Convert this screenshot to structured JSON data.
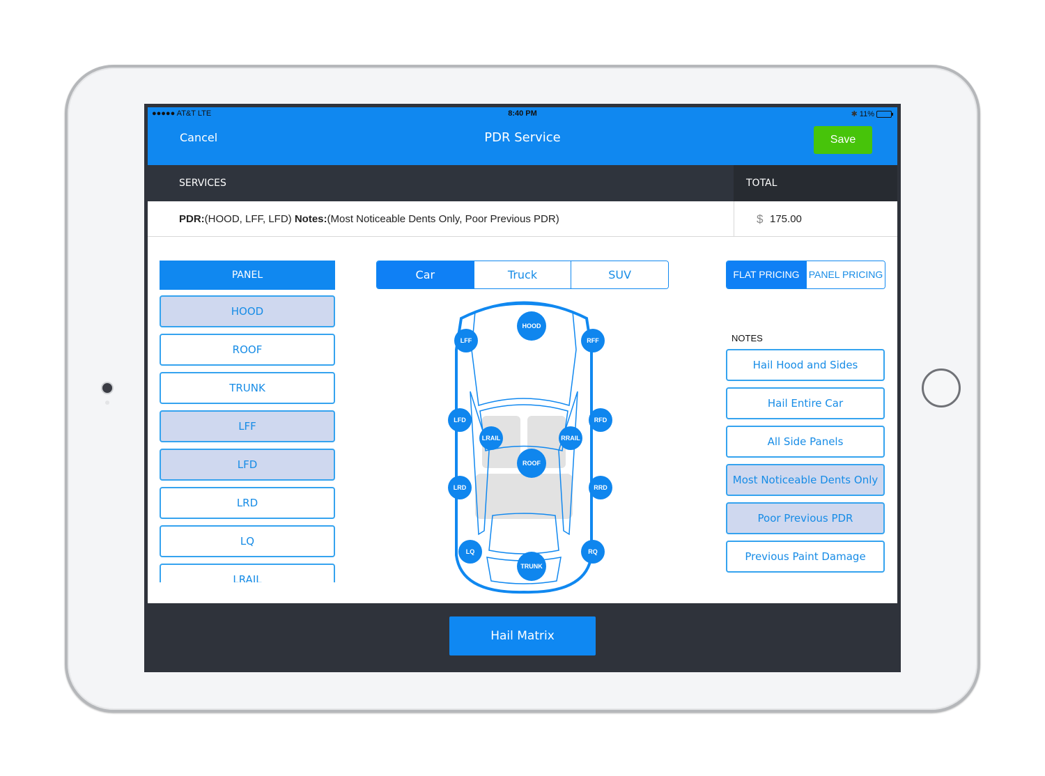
{
  "status_bar": {
    "carrier": "●●●●● AT&T  LTE",
    "time": "8:40 PM",
    "battery": "11%",
    "battery_level": 0.11
  },
  "nav": {
    "cancel_label": "Cancel",
    "title": "PDR Service",
    "save_label": "Save"
  },
  "colors": {
    "primary": "#1088f0",
    "save": "#47c40a",
    "dark": "#2f333b",
    "selected_fill": "#cfd8ef"
  },
  "services_table": {
    "services_header": "SERVICES",
    "total_header": "TOTAL",
    "row": {
      "pdr_label": "PDR:",
      "pdr_value": "(HOOD, LFF, LFD) ",
      "notes_label": "Notes:",
      "notes_value": "(Most Noticeable Dents Only, Poor Previous PDR)",
      "currency": "$",
      "price": "175.00"
    }
  },
  "panel": {
    "header": "PANEL",
    "items": [
      {
        "label": "HOOD",
        "selected": true
      },
      {
        "label": "ROOF",
        "selected": false
      },
      {
        "label": "TRUNK",
        "selected": false
      },
      {
        "label": "LFF",
        "selected": true
      },
      {
        "label": "LFD",
        "selected": true
      },
      {
        "label": "LRD",
        "selected": false
      },
      {
        "label": "LQ",
        "selected": false
      },
      {
        "label": "LRAIL",
        "selected": false
      }
    ]
  },
  "vehicle_types": {
    "options": [
      "Car",
      "Truck",
      "SUV"
    ],
    "selected": "Car"
  },
  "pricing_modes": {
    "options": [
      "FLAT PRICING",
      "PANEL PRICING"
    ],
    "selected": "FLAT PRICING"
  },
  "car_diagram": {
    "markers": [
      "HOOD",
      "LFF",
      "RFF",
      "LFD",
      "RFD",
      "LRAIL",
      "RRAIL",
      "ROOF",
      "LRD",
      "RRD",
      "LQ",
      "RQ",
      "TRUNK"
    ]
  },
  "notes": {
    "label": "NOTES",
    "items": [
      {
        "label": "Hail Hood and Sides",
        "selected": false
      },
      {
        "label": "Hail Entire Car",
        "selected": false
      },
      {
        "label": "All Side Panels",
        "selected": false
      },
      {
        "label": "Most Noticeable Dents Only",
        "selected": true
      },
      {
        "label": "Poor Previous PDR",
        "selected": true
      },
      {
        "label": "Previous Paint Damage",
        "selected": false
      }
    ]
  },
  "footer": {
    "hail_matrix_label": "Hail Matrix"
  }
}
